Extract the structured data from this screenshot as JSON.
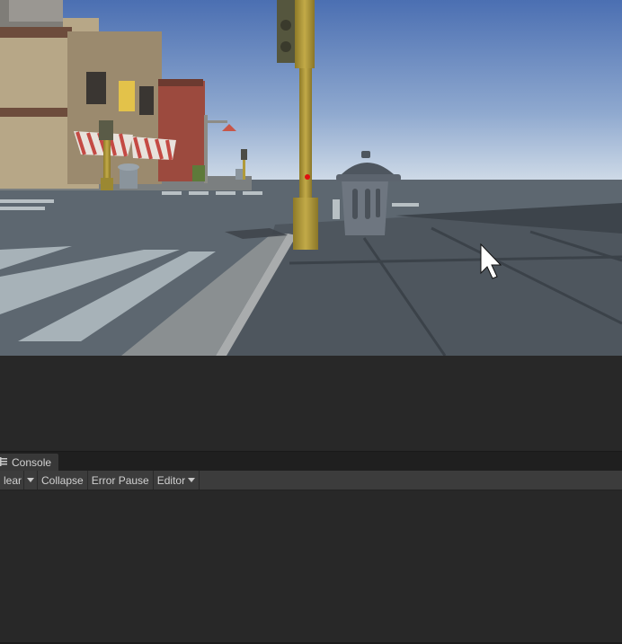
{
  "console": {
    "tab_label": "Console",
    "toolbar": {
      "clear_label": "lear",
      "collapse_label": "Collapse",
      "error_pause_label": "Error Pause",
      "editor_label": "Editor"
    }
  },
  "icons": {
    "console_tab": "console-list-icon",
    "clear_dropdown": "chevron-down-icon",
    "editor_dropdown": "chevron-down-icon",
    "cursor": "mouse-cursor-icon"
  },
  "colors": {
    "sky_top": "#4f74b5",
    "sky_bottom": "#c4d4e4",
    "road": "#5c6670",
    "pole": "#b09a3a",
    "editor_bg": "#282828",
    "toolbar_bg": "#3c3c3c"
  }
}
